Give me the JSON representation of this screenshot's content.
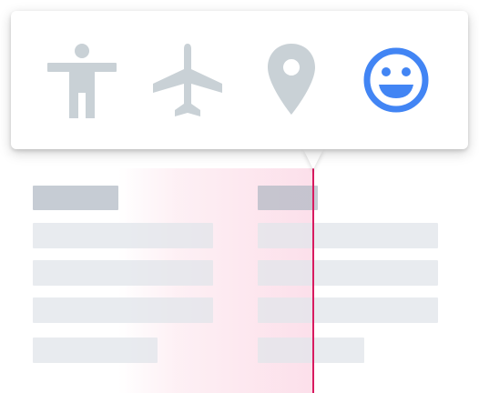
{
  "icon_picker": {
    "icons": [
      {
        "name": "accessibility-icon",
        "state": "default"
      },
      {
        "name": "airplane-icon",
        "state": "default"
      },
      {
        "name": "location-pin-icon",
        "state": "default"
      },
      {
        "name": "smiley-face-icon",
        "state": "selected"
      }
    ]
  },
  "colors": {
    "icon_default": "#c9d1d6",
    "icon_selected": "#4285f4",
    "drag_line": "#d81b60",
    "highlight": "#fce4ec"
  }
}
